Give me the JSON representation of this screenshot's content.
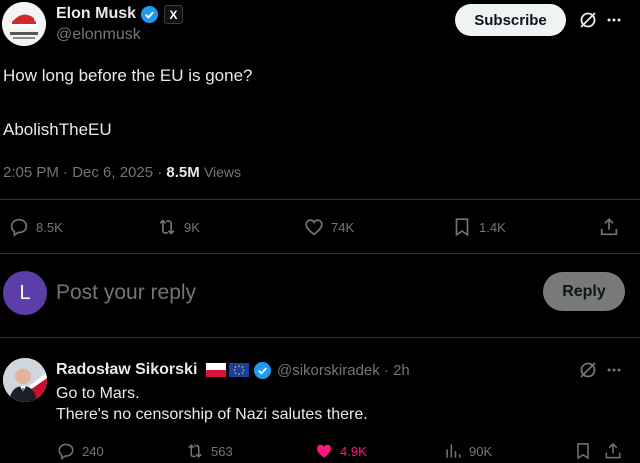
{
  "tweet": {
    "author_name": "Elon Musk",
    "author_handle": "@elonmusk",
    "x_badge": "X",
    "subscribe_label": "Subscribe",
    "text_line1": "How long before the EU is gone?",
    "text_line2": "AbolishTheEU",
    "time": "2:05 PM · Dec 6, 2025 · ",
    "views_count": "8.5M",
    "views_label": "Views",
    "actions": {
      "replies": "8.5K",
      "reposts": "9K",
      "likes": "74K",
      "bookmarks": "1.4K"
    }
  },
  "composer": {
    "avatar_letter": "L",
    "placeholder": "Post your reply",
    "reply_label": "Reply"
  },
  "reply": {
    "author_name": "Radosław Sikorski",
    "author_handle": "@sikorskiradek · 2h",
    "text_line1": "Go to Mars.",
    "text_line2": "There's no censorship of Nazi salutes there.",
    "actions": {
      "replies": "240",
      "reposts": "563",
      "likes": "4.9K",
      "views": "90K"
    }
  },
  "colors": {
    "background": "#000000",
    "verified": "#1d9bf0",
    "like_active": "#f91880",
    "composer_avatar": "#5b3ea8"
  }
}
